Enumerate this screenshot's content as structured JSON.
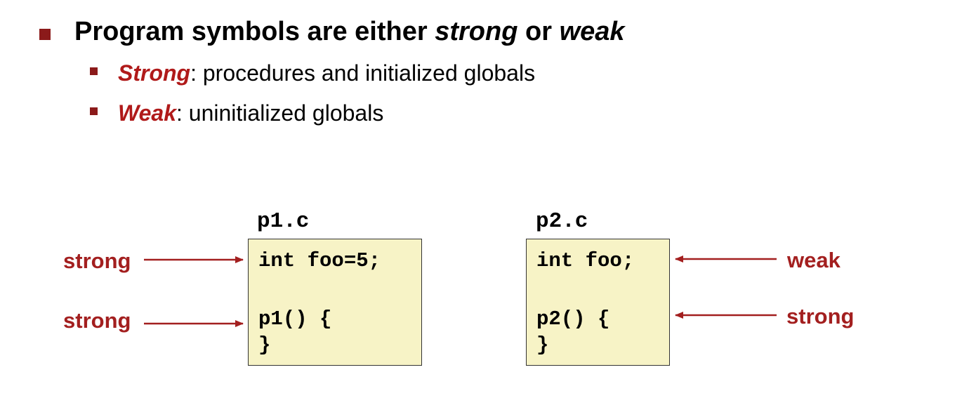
{
  "heading": {
    "pre": "Program symbols are either ",
    "strong_word": "strong",
    "mid": " or ",
    "weak_word": "weak"
  },
  "bullets": [
    {
      "term": "Strong",
      "text": ": procedures and initialized globals"
    },
    {
      "term": "Weak",
      "text": ": uninitialized globals"
    }
  ],
  "files": [
    {
      "name": "p1.c",
      "lines": [
        "int foo=5;",
        "",
        "p1() {",
        "}"
      ]
    },
    {
      "name": "p2.c",
      "lines": [
        "int foo;",
        "",
        "p2() {",
        "}"
      ]
    }
  ],
  "labels": {
    "p1_line1": "strong",
    "p1_line2": "strong",
    "p2_line1": "weak",
    "p2_line2": "strong"
  },
  "colors": {
    "accent": "#a31f1f",
    "bullet": "#8b1a1a",
    "code_bg": "#f7f3c6"
  }
}
